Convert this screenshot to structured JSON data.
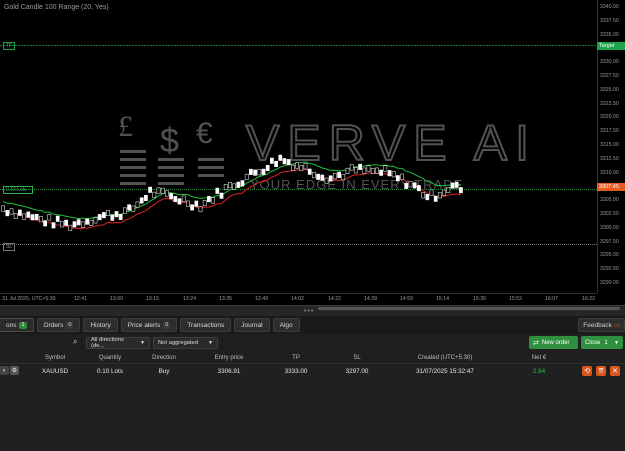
{
  "chart": {
    "title": "Gold Candle 100 Range (20, Yes)",
    "price_ticks": [
      "3340.00",
      "3337.50",
      "3335.00",
      "3332.50",
      "3330.00",
      "3327.50",
      "3325.00",
      "3322.50",
      "3320.00",
      "3317.50",
      "3315.00",
      "3312.50",
      "3310.00",
      "3307.50",
      "3305.00",
      "3302.50",
      "3300.00",
      "3297.50",
      "3295.00",
      "3292.50",
      "3290.00"
    ],
    "time_ticks": [
      "31 Jul 2025, UTC+5:30",
      "12:41",
      "13:00",
      "13:15",
      "13:24",
      "13:35",
      "13:49",
      "14:02",
      "14:22",
      "14:39",
      "14:59",
      "15:14",
      "15:36",
      "15:52",
      "16:07",
      "16:22"
    ],
    "tp_label": "TP",
    "tp_axis_tag": "Target",
    "tp_price": 3333.0,
    "sl_label": "SL",
    "sl_price": 3297.0,
    "entry_label": "0.10 Lots ↑",
    "entry_price": 3306.91,
    "current_price_tag": "3307.45",
    "watermark_text": "VERVE AI",
    "watermark_subtext": "YOUR EDGE IN EVERY TRADE",
    "watermark_symbols": [
      "£",
      "$",
      "€"
    ],
    "colors": {
      "tp_line": "#1fa34a",
      "sl_line": "#9a9a9a",
      "entry_line": "#2db34a",
      "ema_red": "#e02020",
      "ema_green": "#1fbf3a",
      "price_tag": "#e85a1f"
    }
  },
  "tabs": [
    {
      "label": "ons",
      "badge": "1",
      "active": true
    },
    {
      "label": "Orders",
      "badge": "0"
    },
    {
      "label": "History"
    },
    {
      "label": "Price alerts",
      "badge": "0"
    },
    {
      "label": "Transactions"
    },
    {
      "label": "Journal"
    },
    {
      "label": "Algo"
    }
  ],
  "feedback_label": "Feedback",
  "filters": {
    "directions": "All directions (de...",
    "aggregation": "Not aggregated"
  },
  "new_order_label": "New order",
  "close_label": "Close",
  "close_qty": "1",
  "table": {
    "headers": [
      "Symbol",
      "Quantity",
      "Direction",
      "Entry price",
      "TP",
      "SL",
      "Created (UTC+5:30)",
      "Net €"
    ],
    "rows": [
      {
        "symbol": "XAUUSD",
        "quantity": "0.10 Lots",
        "direction": "Buy",
        "entry": "3306.91",
        "tp": "3333.00",
        "sl": "3297.00",
        "created": "31/07/2025 15:32:47",
        "net": "2.84"
      }
    ]
  }
}
